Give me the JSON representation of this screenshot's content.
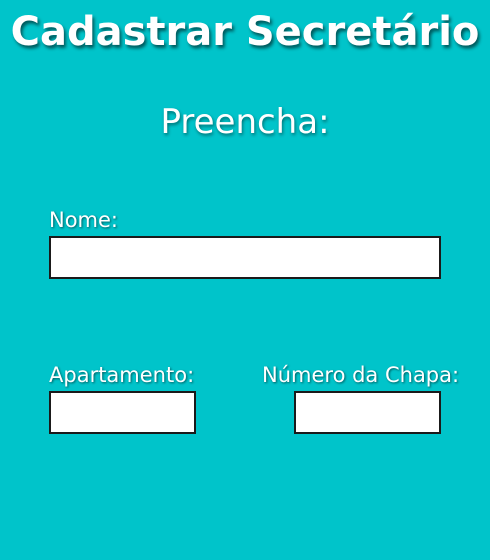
{
  "page": {
    "title": "Cadastrar Secretário",
    "subtitle": "Preencha:"
  },
  "form": {
    "nome": {
      "label": "Nome:",
      "value": ""
    },
    "apartamento": {
      "label": "Apartamento:",
      "value": ""
    },
    "numero_chapa": {
      "label": "Número da Chapa:",
      "value": ""
    }
  },
  "colors": {
    "background": "#00c4ca",
    "text": "#ffffff",
    "field_background": "#ffffff",
    "field_border": "#1a1a1a"
  }
}
